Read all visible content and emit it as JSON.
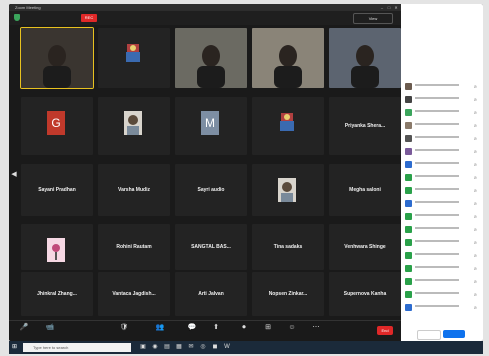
{
  "window": {
    "title": "Zoom Meeting"
  },
  "topbar": {
    "rec_label": "REC",
    "view_label": "View",
    "status_left": "",
    "status_mid": ""
  },
  "tiles_row1": [
    {
      "name": "",
      "kind": "video",
      "active": true
    },
    {
      "name": "",
      "kind": "logo"
    },
    {
      "name": "",
      "kind": "video"
    },
    {
      "name": "",
      "kind": "video"
    },
    {
      "name": "",
      "kind": "video"
    }
  ],
  "tiles_row2": [
    {
      "name": "",
      "kind": "letter",
      "letter": "G",
      "color": "#c0392b"
    },
    {
      "name": "",
      "kind": "photo"
    },
    {
      "name": "",
      "kind": "letter",
      "letter": "M",
      "color": "#7d8ea3"
    },
    {
      "name": "",
      "kind": "logo"
    },
    {
      "name": "Priyanka Shera...",
      "kind": "name"
    }
  ],
  "tiles_row3": [
    {
      "name": "Sayani Pradhan",
      "kind": "name"
    },
    {
      "name": "Varsha Mudiz",
      "kind": "name"
    },
    {
      "name": "Sayri audio",
      "kind": "name"
    },
    {
      "name": "",
      "kind": "photo"
    },
    {
      "name": "Megha saloni",
      "kind": "name"
    }
  ],
  "tiles_row4": [
    {
      "name": "",
      "kind": "pink"
    },
    {
      "name": "Rohini Rautam",
      "kind": "name"
    },
    {
      "name": "SANGTAL BAS...",
      "kind": "name"
    },
    {
      "name": "Tina sadaks",
      "kind": "name"
    },
    {
      "name": "Venhwara Shinge",
      "kind": "name"
    }
  ],
  "tiles_row5": [
    {
      "name": "Jhinkral Zhang...",
      "kind": "name"
    },
    {
      "name": "Vantaca Jagdish...",
      "kind": "name"
    },
    {
      "name": "Arti Jalvan",
      "kind": "name"
    },
    {
      "name": "Nopsen Zinkar...",
      "kind": "name"
    },
    {
      "name": "Supernova Kanha",
      "kind": "name"
    }
  ],
  "toolbar": {
    "items": [
      {
        "icon": "🎤",
        "label": ""
      },
      {
        "icon": "📹",
        "label": ""
      },
      {
        "icon": "🛡",
        "label": ""
      },
      {
        "icon": "👥",
        "label": ""
      },
      {
        "icon": "💬",
        "label": ""
      },
      {
        "icon": "⬆",
        "label": ""
      },
      {
        "icon": "⏺",
        "label": ""
      },
      {
        "icon": "⊞",
        "label": ""
      },
      {
        "icon": "☺",
        "label": ""
      },
      {
        "icon": "⋯",
        "label": ""
      }
    ],
    "end_label": "End"
  },
  "panel": {
    "title": "",
    "waiting_label": "",
    "admit_label": "",
    "in_meeting_label": "",
    "participants": [
      {
        "color": "#6b5b4f"
      },
      {
        "color": "#444"
      },
      {
        "color": "#3ba55c"
      },
      {
        "color": "#8a7a6a"
      },
      {
        "color": "#555"
      },
      {
        "color": "#7a5a9a"
      },
      {
        "color": "#2d6ccf"
      },
      {
        "color": "#2aa14a"
      },
      {
        "color": "#2aa14a"
      },
      {
        "color": "#2d6ccf"
      },
      {
        "color": "#2aa14a"
      },
      {
        "color": "#2aa14a"
      },
      {
        "color": "#2aa14a"
      },
      {
        "color": "#2aa14a"
      },
      {
        "color": "#2aa14a"
      },
      {
        "color": "#2aa14a"
      },
      {
        "color": "#2aa14a"
      },
      {
        "color": "#2d6ccf"
      }
    ],
    "invite_label": "",
    "mute_label": ""
  },
  "taskbar": {
    "search_placeholder": "Type here to search",
    "time": "",
    "date": ""
  }
}
